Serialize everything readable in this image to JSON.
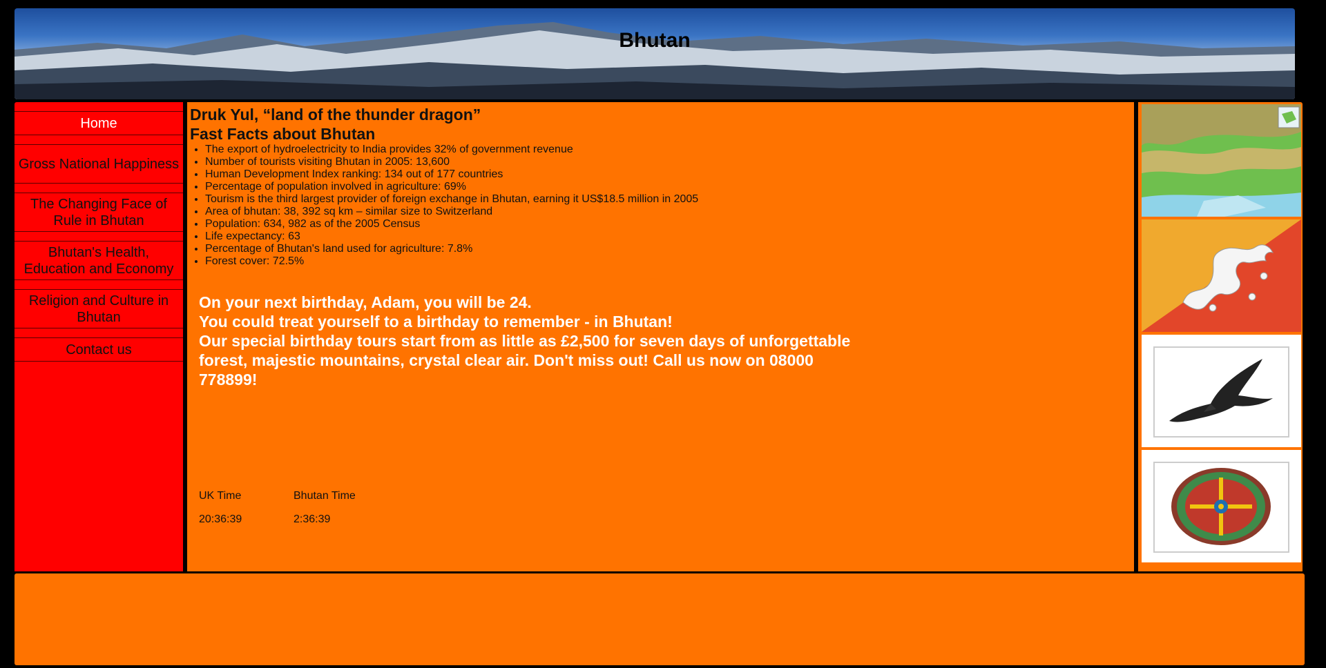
{
  "header": {
    "title": "Bhutan"
  },
  "nav": {
    "home": "Home",
    "gnh": "Gross National Happiness",
    "rule": "The Changing Face of Rule in Bhutan",
    "health": "Bhutan's Health, Education and Economy",
    "religion": "Religion and Culture in Bhutan",
    "contact": "Contact us"
  },
  "main": {
    "heading": "Druk Yul, “land of the thunder dragon”",
    "facts_heading": "Fast Facts about Bhutan",
    "facts": [
      "The export of hydroelectricity to India provides 32% of government revenue",
      "Number of tourists visiting Bhutan in 2005: 13,600",
      "Human Development Index ranking: 134 out of 177 countries",
      "Percentage of population involved in agriculture: 69%",
      "Tourism is the third largest provider of foreign exchange in Bhutan, earning it US$18.5 million in 2005",
      "Area of bhutan: 38, 392 sq km – similar size to Switzerland",
      "Population: 634, 982 as of the 2005 Census",
      "Life expectancy: 63",
      "Percentage of Bhutan's land used for agriculture: 7.8%",
      "Forest cover: 72.5%"
    ],
    "promo_line1": "On your next birthday, Adam, you will be 24.",
    "promo_line2": "You could treat yourself to a birthday to remember - in Bhutan!",
    "promo_line3": "Our special birthday tours start from as little as £2,500 for seven days of unforgettable forest, majestic mountains, crystal clear air. Don't miss out! Call us now on 08000 778899!"
  },
  "clock": {
    "uk_label": "UK Time",
    "uk_time": "20:36:39",
    "bhutan_label": "Bhutan Time",
    "bhutan_time": "2:36:39"
  },
  "images": [
    "map-image",
    "flag-image",
    "raven-image",
    "mandala-image"
  ],
  "colors": {
    "nav": "#ff0000",
    "content": "#ff7300",
    "background": "#000000"
  }
}
